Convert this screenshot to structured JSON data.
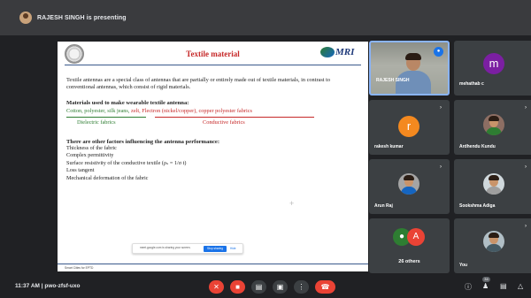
{
  "meeting": {
    "presenting_banner": "RAJESH SINGH is presenting",
    "time": "11:37 AM",
    "separator": "|",
    "meeting_code": "pwo-zfsf-uxo"
  },
  "slide": {
    "title": "Textile material",
    "logo_right_text": "MRI",
    "intro": "Textile antennas are a special class of antennas that are partially or entirely made out of textile materials, in contrast to conventional antennas, which consist of rigid materials.",
    "materials_heading": "Materials used to make wearable textile antenna:",
    "dielectric_list": "Cotton, polyester, silk jeans,",
    "conductive_list": "zelt, Flectron (nickel/copper), copper polyester fabrics",
    "dielectric_label": "Dielectric fabrics",
    "conductive_label": "Conductive fabrics",
    "factors_heading": "There are other factors influencing the antenna performance:",
    "factors": [
      "Thickness of the fabric",
      "Complex permittivity",
      "Surface resistivity of the conductive textile (ρₛ = 1/σ t)",
      "Loss tangent",
      "Mechanical deformation of the fabric"
    ],
    "footer": "Smart Cities for EPTD",
    "share_bar": {
      "text": "meet.google.com is sharing your screen.",
      "stop_label": "Stop sharing",
      "hide_label": "Hide"
    }
  },
  "participants": [
    {
      "name": "RAJESH SINGH",
      "type": "video"
    },
    {
      "name": "mehathab c",
      "type": "letter",
      "letter": "m",
      "color": "#7b1fa2"
    },
    {
      "name": "rakesh kumar",
      "type": "letter",
      "letter": "r",
      "color": "#f4891f"
    },
    {
      "name": "Ardhendu Kundu",
      "type": "photo",
      "shirt": "#2e7d32"
    },
    {
      "name": "Arun Raj",
      "type": "photo",
      "shirt": "#1565c0"
    },
    {
      "name": "Sookshma Adiga",
      "type": "photo",
      "shirt": "#9e9e9e"
    },
    {
      "name": "26 others",
      "type": "others",
      "letter": "A"
    },
    {
      "name": "You",
      "type": "photo",
      "shirt": "#455a64"
    }
  ],
  "controls": {
    "people_count": "34",
    "colors": {
      "accent": "#1a73e8",
      "danger": "#ea4335",
      "tile": "#3c4043",
      "bg": "#202124"
    }
  }
}
